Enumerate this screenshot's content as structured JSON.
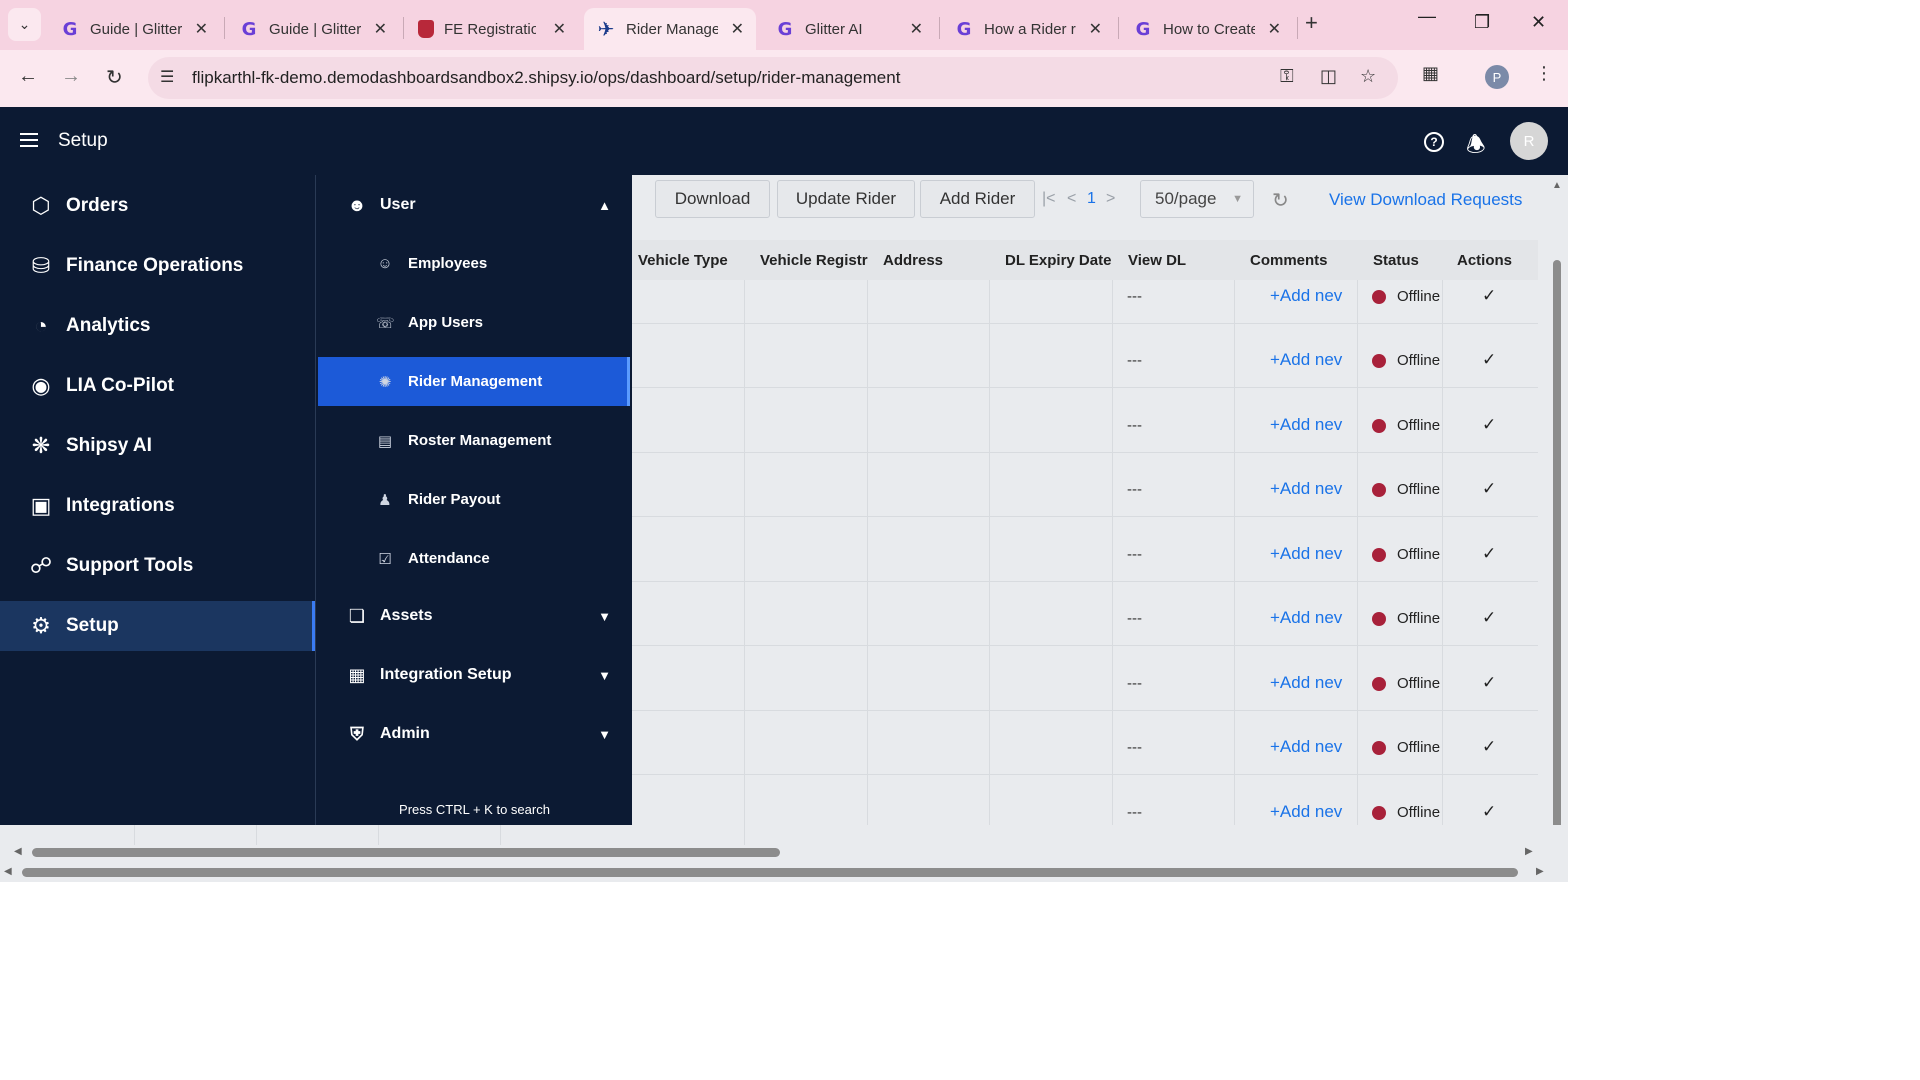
{
  "browser": {
    "tabs": [
      {
        "title": "Guide | Glitter AI",
        "favicon": "glitter-icon"
      },
      {
        "title": "Guide | Glitter AI",
        "favicon": "glitter-icon"
      },
      {
        "title": "FE Registration",
        "favicon": "fe-icon"
      },
      {
        "title": "Rider Management",
        "favicon": "shipsy-icon",
        "active": true
      },
      {
        "title": "Glitter AI",
        "favicon": "glitter-icon"
      },
      {
        "title": "How a Rider r",
        "favicon": "glitter-icon"
      },
      {
        "title": "How to Create",
        "favicon": "glitter-icon"
      }
    ],
    "url": "flipkarthl-fk-demo.demodashboardsandbox2.shipsy.io/ops/dashboard/setup/rider-management",
    "profile_initial": "P"
  },
  "header": {
    "title": "Setup",
    "avatar_initial": "R",
    "help_glyph": "?"
  },
  "sidebar": {
    "items": [
      {
        "label": "Orders",
        "icon": "cube-icon"
      },
      {
        "label": "Finance Operations",
        "icon": "coins-icon"
      },
      {
        "label": "Analytics",
        "icon": "pie-chart-icon"
      },
      {
        "label": "LIA Co-Pilot",
        "icon": "copilot-icon"
      },
      {
        "label": "Shipsy AI",
        "icon": "ai-brain-icon"
      },
      {
        "label": "Integrations",
        "icon": "integrations-icon"
      },
      {
        "label": "Support Tools",
        "icon": "headset-icon"
      },
      {
        "label": "Setup",
        "icon": "gear-icon",
        "active": true
      }
    ]
  },
  "submenu": {
    "user_section": "User",
    "items": [
      {
        "label": "Employees",
        "icon": "employees-icon"
      },
      {
        "label": "App Users",
        "icon": "app-users-icon"
      },
      {
        "label": "Rider Management",
        "icon": "rider-icon",
        "active": true
      },
      {
        "label": "Roster Management",
        "icon": "roster-icon"
      },
      {
        "label": "Rider Payout",
        "icon": "payout-icon"
      },
      {
        "label": "Attendance",
        "icon": "calendar-check-icon"
      }
    ],
    "sections": [
      {
        "label": "Assets",
        "icon": "assets-icon"
      },
      {
        "label": "Integration Setup",
        "icon": "integration-setup-icon"
      },
      {
        "label": "Admin",
        "icon": "shield-icon"
      }
    ],
    "search_hint": "Press CTRL + K to search"
  },
  "toolbar": {
    "download": "Download",
    "update_rider": "Update Rider",
    "add_rider": "Add Rider",
    "page": "1",
    "page_size": "50/page",
    "view_download_requests": "View Download Requests"
  },
  "table": {
    "columns": [
      "Vehicle Type",
      "Vehicle Registrat",
      "Address",
      "DL Expiry Date",
      "View DL",
      "Comments",
      "Status",
      "Actions"
    ],
    "rows": [
      {
        "view_dl": "---",
        "comments": "+Add nev",
        "status": "Offline",
        "action": "✓"
      },
      {
        "view_dl": "---",
        "comments": "+Add nev",
        "status": "Offline",
        "action": "✓"
      },
      {
        "view_dl": "---",
        "comments": "+Add nev",
        "status": "Offline",
        "action": "✓"
      },
      {
        "view_dl": "---",
        "comments": "+Add nev",
        "status": "Offline",
        "action": "✓"
      },
      {
        "view_dl": "---",
        "comments": "+Add nev",
        "status": "Offline",
        "action": "✓"
      },
      {
        "view_dl": "---",
        "comments": "+Add nev",
        "status": "Offline",
        "action": "✓"
      },
      {
        "view_dl": "---",
        "comments": "+Add nev",
        "status": "Offline",
        "action": "✓"
      },
      {
        "view_dl": "---",
        "comments": "+Add nev",
        "status": "Offline",
        "action": "✓"
      },
      {
        "view_dl": "---",
        "comments": "+Add nev",
        "status": "Offline",
        "action": "✓"
      }
    ]
  },
  "colors": {
    "nav_bg": "#0c1a33",
    "active_submenu": "#1c5ad8",
    "link": "#1a73e8",
    "offline_dot": "#a8213a"
  }
}
